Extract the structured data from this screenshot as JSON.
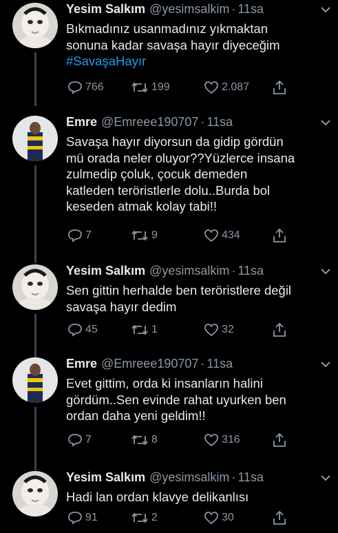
{
  "tweets": [
    {
      "name": "Yesim Salkım",
      "handle": "@yesimsalkim",
      "separator": "·",
      "time": "11sa",
      "lines": [
        "Bıkmadınız usanmadınız yıkmaktan",
        "sonuna kadar savaşa hayır diyeceğim"
      ],
      "hashtag": "#SavaşaHayır",
      "replies": "766",
      "retweets": "199",
      "likes": "2.087"
    },
    {
      "name": "Emre",
      "handle": "@Emreee190707",
      "separator": "·",
      "time": "11sa",
      "lines": [
        "Savaşa hayır diyorsun da gidip gördün",
        "mü orada neler oluyor??Yüzlerce insana",
        "zulmedip çoluk, çocuk demeden",
        "katleden teröristlerle dolu..Burda bol",
        "keseden atmak kolay tabi!!"
      ],
      "replies": "7",
      "retweets": "9",
      "likes": "434"
    },
    {
      "name": "Yesim Salkım",
      "handle": "@yesimsalkim",
      "separator": "·",
      "time": "11sa",
      "lines": [
        "Sen gittin herhalde ben teröristlere değil",
        "savaşa hayır dedim"
      ],
      "replies": "45",
      "retweets": "1",
      "likes": "32"
    },
    {
      "name": "Emre",
      "handle": "@Emreee190707",
      "separator": "·",
      "time": "11sa",
      "lines": [
        "Evet gittim, orda ki insanların halini",
        "gördüm..Sen evinde rahat uyurken ben",
        "ordan daha yeni geldim!!"
      ],
      "replies": "7",
      "retweets": "8",
      "likes": "316"
    },
    {
      "name": "Yesim Salkım",
      "handle": "@yesimsalkim",
      "separator": "·",
      "time": "11sa",
      "lines": [
        "Hadi lan ordan klavye delikanlısı"
      ],
      "replies": "91",
      "retweets": "2",
      "likes": "30"
    }
  ],
  "colors": {
    "background": "#000000",
    "text": "#e7e9ea",
    "secondary": "#8b98a5",
    "hashtag": "#1d9bf0",
    "thread_line": "#3a444d"
  },
  "icons": [
    "caret-down-icon",
    "reply-icon",
    "retweet-icon",
    "like-icon",
    "share-icon"
  ]
}
